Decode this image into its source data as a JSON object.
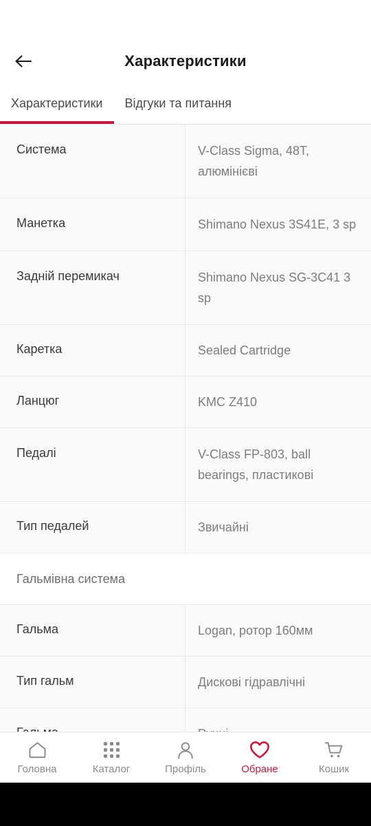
{
  "app_bar": {
    "back_icon": "arrow-left-icon",
    "title": "Характеристики"
  },
  "tabs": [
    {
      "label": "Характеристики",
      "active": true
    },
    {
      "label": "Відгуки та питання",
      "active": false
    }
  ],
  "spec_table": {
    "rows": [
      {
        "type": "spec",
        "label": "Система",
        "value": "V-Class Sigma, 48T, алюмінієві",
        "lines": 2
      },
      {
        "type": "spec",
        "label": "Манетка",
        "value": "Shimano Nexus 3S41E, 3 sp",
        "lines": 2
      },
      {
        "type": "spec",
        "label": "Задній перемикач",
        "value": "Shimano Nexus SG-3C41 3 sp",
        "lines": 2
      },
      {
        "type": "spec",
        "label": "Каретка",
        "value": "Sealed Cartridge",
        "lines": 1
      },
      {
        "type": "spec",
        "label": "Ланцюг",
        "value": "KMC Z410",
        "lines": 1
      },
      {
        "type": "spec",
        "label": "Педалі",
        "value": "V-Class FP-803, ball bearings, пластикові",
        "lines": 2
      },
      {
        "type": "spec",
        "label": "Тип педалей",
        "value": "Звичайні",
        "lines": 1
      },
      {
        "type": "section",
        "label": "Гальмівна система"
      },
      {
        "type": "spec",
        "label": "Гальма",
        "value": "Logan, ротор 160мм",
        "lines": 1
      },
      {
        "type": "spec",
        "label": "Тип гальм",
        "value": "Дискові гідравлічні",
        "lines": 1
      },
      {
        "type": "spec",
        "label": "Гальма",
        "value": "Ручні",
        "lines": 1
      }
    ]
  },
  "bottom_nav": {
    "items": [
      {
        "label": "Головна",
        "icon": "home-icon",
        "active": false
      },
      {
        "label": "Каталог",
        "icon": "grid-icon",
        "active": false
      },
      {
        "label": "Профіль",
        "icon": "person-icon",
        "active": false
      },
      {
        "label": "Обране",
        "icon": "heart-icon",
        "active": true
      },
      {
        "label": "Кошик",
        "icon": "cart-icon",
        "active": false
      }
    ]
  },
  "colors": {
    "accent": "#C4193F",
    "label_text": "#3a3a3a",
    "value_text": "#7d7d7d",
    "row_bg": "#fafafa",
    "divider": "#eaeaea",
    "nav_inactive": "#8a8a8a",
    "system_nav_bg": "#000000"
  }
}
